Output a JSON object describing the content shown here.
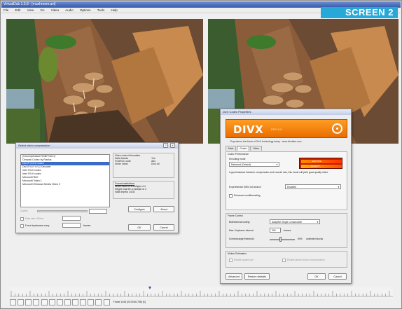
{
  "window": {
    "title": "VirtualDub 1.5.8 - [mushroom.avi]",
    "menu": [
      "File",
      "Edit",
      "View",
      "Go",
      "Video",
      "Audio",
      "Options",
      "Tools",
      "Help"
    ]
  },
  "badge": "SCREEN 2",
  "compression_dialog": {
    "title": "Select video compression",
    "codecs": [
      "(Uncompressed RGB/YCbCr)",
      "Cinepak Codec by Radius",
      "DivX® 5.0.5 Codec",
      "DivX® 6.0 YV12 Decoder",
      "Intel IYUV codec",
      "Intel IYUV codec",
      "Microsoft RLE",
      "Microsoft Video 1",
      "Microsoft Windows Media Video 9"
    ],
    "selected_index": 2,
    "info_title": "Video codec information",
    "info_rows": [
      [
        "Delta frames",
        "Yes"
      ],
      [
        "FOURCC code",
        "divx"
      ],
      [
        "Driver name",
        "DivX.dll"
      ]
    ],
    "format_title": "Format restrictions",
    "format_lines": [
      "Width must be a multiple of 4",
      "Height must be a multiple of 2",
      "Valid depths: 24/32"
    ],
    "quality_label": "Quality",
    "datarate_label": "Data rate: KB/sec",
    "keyframe_label": "Force keyframes every",
    "frames_label": "frames",
    "buttons": {
      "configure": "Configure",
      "about": "About",
      "ok": "OK",
      "cancel": "Cancel"
    },
    "help_btn": "?",
    "close_btn": "X"
  },
  "divx_dialog": {
    "title": "DivX Codec Properties",
    "banner_logo": "DIVX",
    "banner_sub": "PRO 6.0",
    "tagline": "Experience the future of DivX technology today - www.divxlabs.com",
    "tabs": [
      "Main",
      "Codec",
      "Video"
    ],
    "codec_perf_label": "Codec Performance",
    "encoding_mode_label": "Encoding mode",
    "encoding_mode_value": "Balanced (Default)",
    "meter_top": "ENCODE",
    "meter_bottom": "QUALITY",
    "balance_text": "A good balance between compression and encode rate, this mode will yield good quality video.",
    "sse_label": "Experimental SSE4 full search",
    "sse_value": "Disabled",
    "multithread_label": "Enhanced multithreading",
    "frame_control_label": "Frame Control",
    "bframe_label": "Bidirectional coding",
    "bframe_value": "Adaptive Single Consecutive",
    "keyframe_label": "Max. Keyframe interval",
    "keyframe_value": "300",
    "keyframe_unit": "frames",
    "scene_label": "Scenechange threshold",
    "scene_value": "50%",
    "scene_unit": "unlimited blocks",
    "motion_label": "Motion Estimation",
    "motion_opt1": "Enable quarter-pel",
    "motion_opt2": "Enable global motion compensation",
    "buttons": {
      "advanced": "Advanced",
      "restore": "Restore defaults",
      "ok": "OK",
      "cancel": "Cancel"
    }
  },
  "status": {
    "frame_text": "Frame 1448 (00:00:56.758) [K]"
  },
  "colors": {
    "accent": "#26a8d8",
    "divx_orange": "#ee7a00",
    "selection": "#3a6bc6"
  }
}
